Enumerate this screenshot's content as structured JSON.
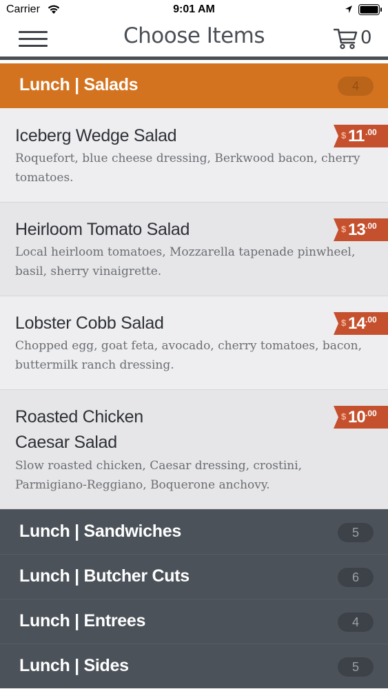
{
  "status_bar": {
    "carrier": "Carrier",
    "time": "9:01 AM"
  },
  "nav": {
    "title": "Choose Items",
    "cart_count": "0"
  },
  "active_category": {
    "label": "Lunch | Salads",
    "count": "4"
  },
  "items": [
    {
      "name": "Iceberg Wedge Salad",
      "description": "Roquefort, blue cheese dressing, Berkwood bacon, cherry tomatoes.",
      "price_currency": "$",
      "price_whole": "11",
      "price_cents": ".00"
    },
    {
      "name": "Heirloom Tomato Salad",
      "description": "Local heirloom tomatoes, Mozzarella tapenade pinwheel, basil, sherry vinaigrette.",
      "price_currency": "$",
      "price_whole": "13",
      "price_cents": ".00"
    },
    {
      "name": "Lobster Cobb Salad",
      "description": "Chopped egg, goat feta, avocado, cherry tomatoes, bacon, buttermilk ranch dressing.",
      "price_currency": "$",
      "price_whole": "14",
      "price_cents": ".00"
    },
    {
      "name": "Roasted Chicken Caesar Salad",
      "description": "Slow roasted chicken, Caesar dressing, crostini, Parmigiano-Reggiano, Boquerone anchovy.",
      "price_currency": "$",
      "price_whole": "10",
      "price_cents": ".00"
    }
  ],
  "categories": [
    {
      "label": "Lunch | Sandwiches",
      "count": "5"
    },
    {
      "label": "Lunch | Butcher Cuts",
      "count": "6"
    },
    {
      "label": "Lunch | Entrees",
      "count": "4"
    },
    {
      "label": "Lunch | Sides",
      "count": "5"
    }
  ],
  "colors": {
    "accent_orange": "#d4731f",
    "price_ribbon": "#c5502e",
    "category_dark": "#4b5259"
  },
  "icons": [
    "wifi-icon",
    "location-arrow-icon",
    "battery-icon",
    "hamburger-menu-icon",
    "cart-icon"
  ]
}
